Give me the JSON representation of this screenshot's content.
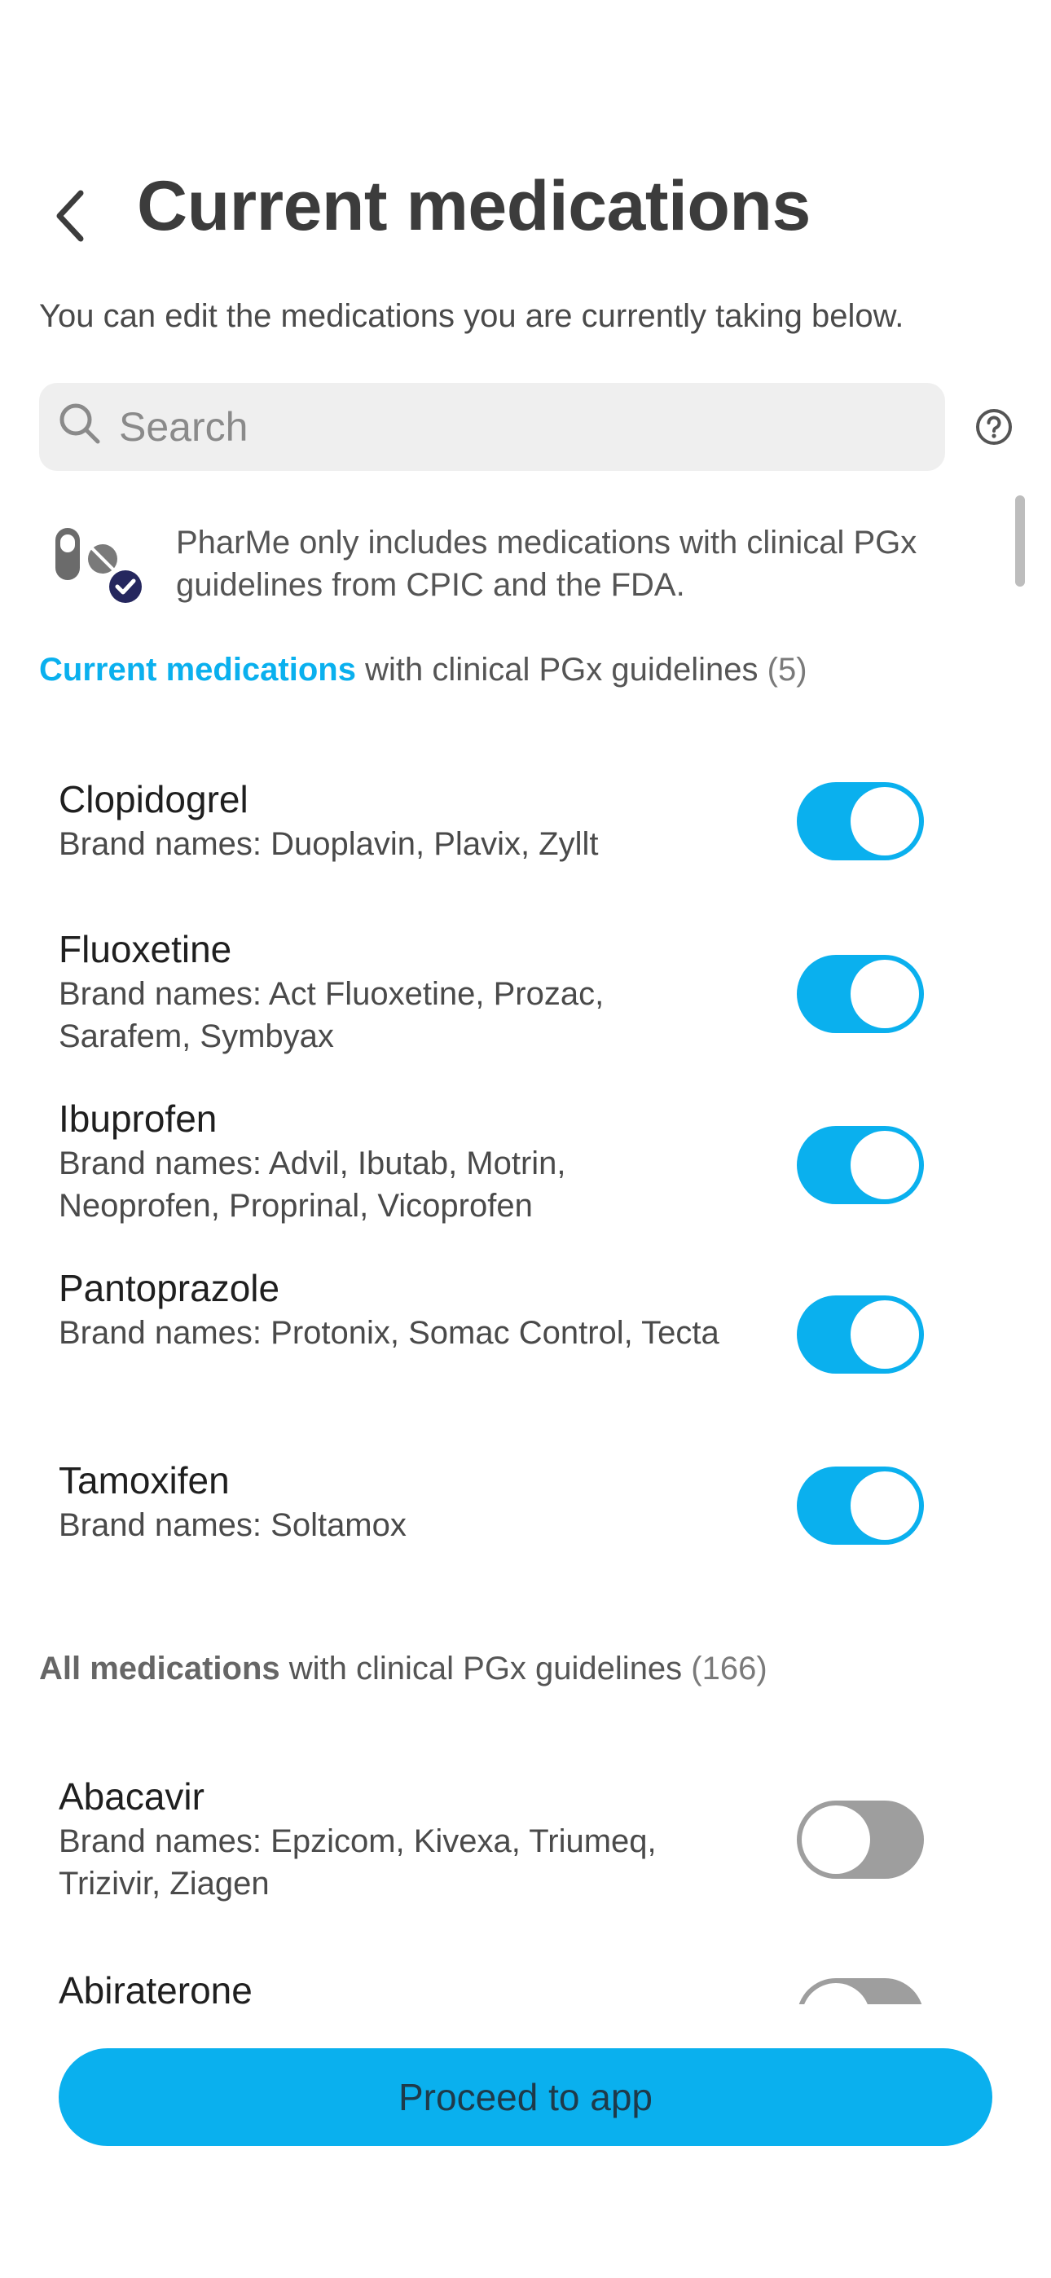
{
  "header": {
    "title": "Current medications",
    "back_icon": "chevron-left-icon"
  },
  "subtitle": "You can edit the medications you are currently taking below.",
  "search": {
    "placeholder": "Search",
    "value": "",
    "icon": "search-icon",
    "help_icon": "question-circle-icon"
  },
  "info": {
    "icon": "pills-check-icon",
    "text": "PharMe only includes medications with clinical PGx guidelines from CPIC and the FDA."
  },
  "current_section": {
    "label_strong": "Current medications",
    "label_rest": " with clinical PGx guidelines ",
    "count": "(5)",
    "accent": "#0ab0ee",
    "items": [
      {
        "name": "Clopidogrel",
        "brands": "Brand names: Duoplavin, Plavix, Zyllt",
        "enabled": true
      },
      {
        "name": "Fluoxetine",
        "brands": "Brand names: Act Fluoxetine, Prozac, Sarafem, Symbyax",
        "enabled": true
      },
      {
        "name": "Ibuprofen",
        "brands": "Brand names: Advil, Ibutab, Motrin, Neoprofen, Proprinal, Vicoprofen",
        "enabled": true
      },
      {
        "name": "Pantoprazole",
        "brands": "Brand names: Protonix, Somac Control, Tecta",
        "enabled": true
      },
      {
        "name": "Tamoxifen",
        "brands": "Brand names: Soltamox",
        "enabled": true
      }
    ]
  },
  "all_section": {
    "label_strong": "All medications",
    "label_rest": " with clinical PGx guidelines ",
    "count": "(166)",
    "items": [
      {
        "name": "Abacavir",
        "brands": "Brand names: Epzicom, Kivexa, Triumeq, Trizivir, Ziagen",
        "enabled": false
      },
      {
        "name": "Abiraterone",
        "brands": "",
        "enabled": false
      }
    ]
  },
  "footer": {
    "proceed_label": "Proceed to app"
  },
  "colors": {
    "accent": "#0ab0ee",
    "toggle_off": "#9e9e9e",
    "title": "#3c3c3c"
  }
}
